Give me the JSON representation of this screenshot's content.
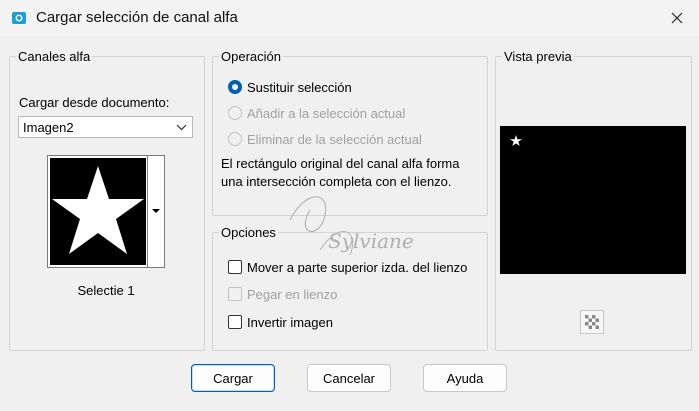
{
  "window": {
    "title": "Cargar selección de canal alfa"
  },
  "alpha_channels": {
    "legend": "Canales alfa",
    "load_from_label": "Cargar desde documento:",
    "document_selected": "Imagen2",
    "channel_name": "Selectie 1"
  },
  "operation": {
    "legend": "Operación",
    "options": [
      {
        "label": "Sustituir selección",
        "checked": true,
        "enabled": true
      },
      {
        "label": "Añadir a la selección actual",
        "checked": false,
        "enabled": false
      },
      {
        "label": "Eliminar de la selección actual",
        "checked": false,
        "enabled": false
      }
    ],
    "note": "El rectángulo original del canal alfa forma una intersección completa con el lienzo."
  },
  "options": {
    "legend": "Opciones",
    "items": [
      {
        "label": "Mover a parte superior izda. del lienzo",
        "checked": false,
        "enabled": true
      },
      {
        "label": "Pegar en lienzo",
        "checked": false,
        "enabled": false
      },
      {
        "label": "Invertir imagen",
        "checked": false,
        "enabled": true
      }
    ]
  },
  "preview": {
    "legend": "Vista previa"
  },
  "buttons": {
    "load": "Cargar",
    "cancel": "Cancelar",
    "help": "Ayuda"
  },
  "watermark": {
    "text": "Sylviane"
  },
  "colors": {
    "accent": "#005fb8",
    "preview_bg": "#000000"
  }
}
